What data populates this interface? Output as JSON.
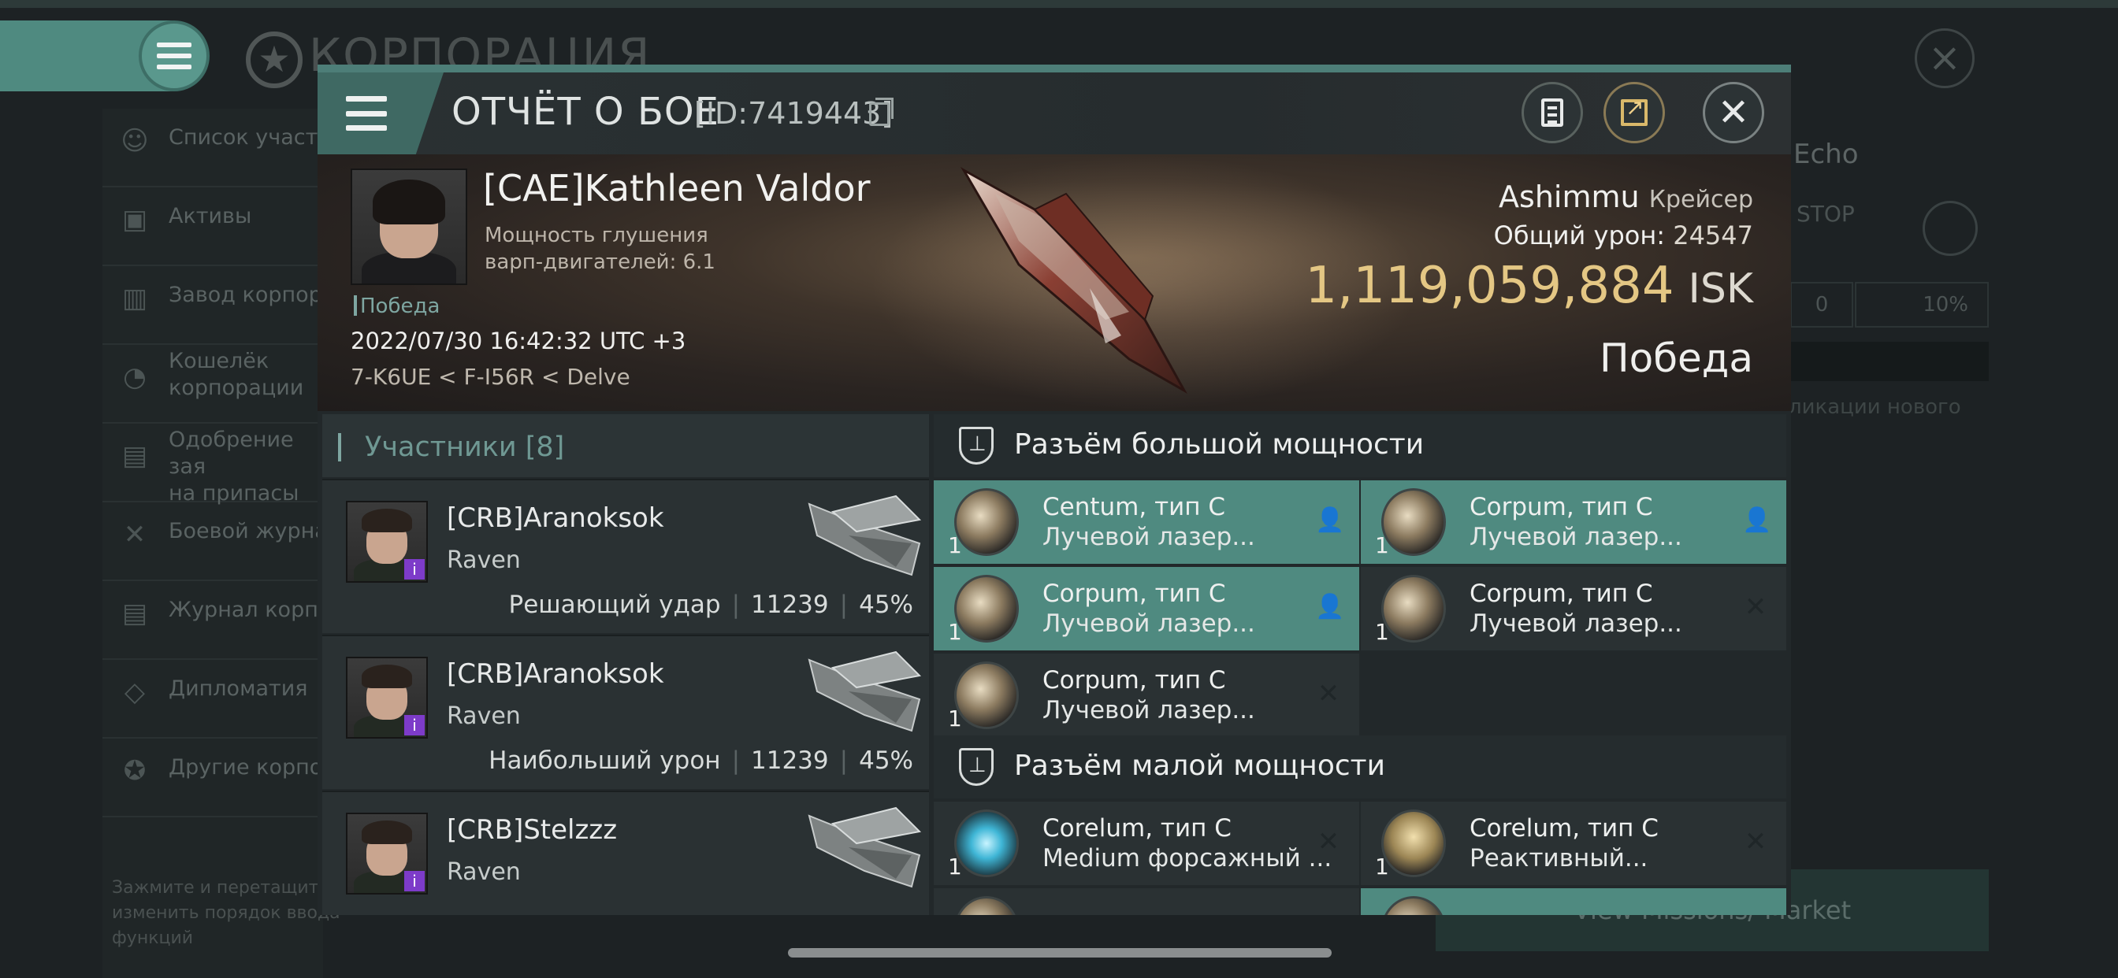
{
  "background": {
    "corp_title": "КОРПОРАЦИЯ",
    "sidebar": [
      {
        "icon": "members-icon",
        "label": "Список участн"
      },
      {
        "icon": "assets-icon",
        "label": "Активы"
      },
      {
        "icon": "factory-icon",
        "label": "Завод корпора"
      },
      {
        "icon": "wallet-icon",
        "label": "Кошелёк\nкорпорации"
      },
      {
        "icon": "supply-icon",
        "label": "Одобрение зая\nна припасы"
      },
      {
        "icon": "combat-log-icon",
        "label": "Боевой журнал"
      },
      {
        "icon": "journal-icon",
        "label": "Журнал корпор"
      },
      {
        "icon": "diplomacy-icon",
        "label": "Дипломатия"
      },
      {
        "icon": "other-corps-icon",
        "label": "Другие корпор"
      }
    ],
    "hint": "Зажмите и перетащите изменить порядок ввода функций",
    "echo": "Echo",
    "stop": "STOP",
    "box0": "0",
    "box10": "10%",
    "new_pub": "ликации нового",
    "market": "View Missions/ Market"
  },
  "modal": {
    "title": "ОТЧЁТ О БОЕ",
    "report_id": "[ID:7419443]",
    "victim": {
      "name": "[CAE]Kathleen Valdor",
      "sub": "Мощность глушения варп-двигателей: 6.1",
      "result_tag": "Победа",
      "datetime": "2022/07/30 16:42:32 UTC +3",
      "location": "7-K6UE < F-I56R < Delve"
    },
    "ship": {
      "name": "Ashimmu",
      "class": "Крейсер",
      "dmg_label": "Общий урон:",
      "dmg_value": "24547",
      "isk_value": "1,119,059,884",
      "isk_unit": "ISK",
      "result": "Победа"
    },
    "participants_header": "Участники [8]",
    "participants": [
      {
        "name": "[CRB]Aranoksok",
        "ship": "Raven",
        "role": "Решающий удар",
        "damage": "11239",
        "percent": "45%"
      },
      {
        "name": "[CRB]Aranoksok",
        "ship": "Raven",
        "role": "Наибольший урон",
        "damage": "11239",
        "percent": "45%"
      },
      {
        "name": "[CRB]Stelzzz",
        "ship": "Raven",
        "role": "",
        "damage": "",
        "percent": ""
      }
    ],
    "high_slot_header": "Разъём большой мощности",
    "low_slot_header": "Разъём малой мощности",
    "high_slots": [
      {
        "name": "Centum, тип C",
        "desc": "Лучевой лазер...",
        "qty": "1",
        "status": "user-icon",
        "highlighted": true
      },
      {
        "name": "Corpum, тип C",
        "desc": "Лучевой лазер...",
        "qty": "1",
        "status": "user-icon",
        "highlighted": true
      },
      {
        "name": "Corpum, тип C",
        "desc": "Лучевой лазер...",
        "qty": "1",
        "status": "user-icon",
        "highlighted": true
      },
      {
        "name": "Corpum, тип C",
        "desc": "Лучевой лазер...",
        "qty": "1",
        "status": "destroyed-icon",
        "highlighted": false
      },
      {
        "name": "Corpum, тип C",
        "desc": "Лучевой лазер...",
        "qty": "1",
        "status": "destroyed-icon",
        "highlighted": false
      }
    ],
    "low_slots": [
      {
        "name": "Corelum, тип C",
        "desc": "Medium форсажный ...",
        "qty": "1",
        "status": "destroyed-icon",
        "highlighted": false
      },
      {
        "name": "Corelum, тип C",
        "desc": "Реактивный...",
        "qty": "1",
        "status": "destroyed-icon",
        "highlighted": false
      }
    ],
    "colors": {
      "accent": "#4f8a80",
      "isk": "#e4c784",
      "panel": "#2a3133"
    }
  }
}
